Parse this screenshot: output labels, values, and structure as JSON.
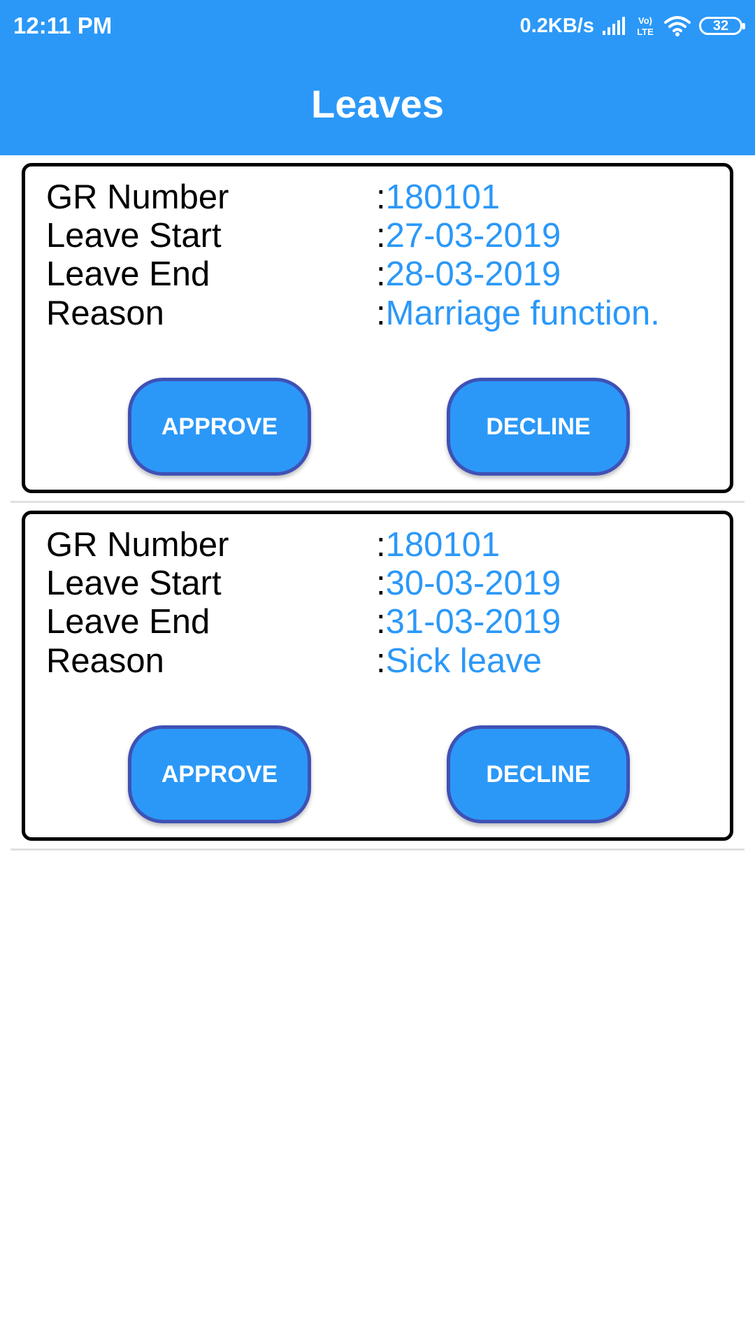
{
  "status_bar": {
    "time": "12:11 PM",
    "network_speed": "0.2KB/s",
    "volte_label": "Vo)\nLTE",
    "battery_level": "32",
    "icons": [
      "signal-icon",
      "volte-icon",
      "wifi-icon",
      "battery-icon"
    ]
  },
  "app_bar": {
    "title": "Leaves"
  },
  "leaves": [
    {
      "gr_label": "GR Number",
      "gr_value": "180101",
      "start_label": "Leave Start",
      "start_value": "27-03-2019",
      "end_label": "Leave End",
      "end_value": "28-03-2019",
      "reason_label": "Reason",
      "reason_value": "Marriage function.",
      "approve_label": "APPROVE",
      "decline_label": "DECLINE"
    },
    {
      "gr_label": "GR Number",
      "gr_value": "180101",
      "start_label": "Leave Start",
      "start_value": "30-03-2019",
      "end_label": "Leave End",
      "end_value": "31-03-2019",
      "reason_label": "Reason",
      "reason_value": "Sick leave",
      "approve_label": "APPROVE",
      "decline_label": "DECLINE"
    }
  ],
  "colors": {
    "primary": "#2b98f8",
    "button_border": "#3f51b5",
    "card_border": "#000000",
    "divider": "#e0e0e0"
  }
}
